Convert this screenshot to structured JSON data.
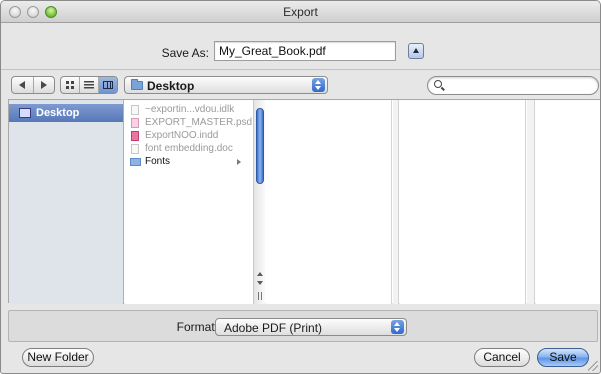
{
  "window": {
    "title": "Export"
  },
  "save_as": {
    "label": "Save As:",
    "value": "My_Great_Book.pdf"
  },
  "toolbar": {
    "location": "Desktop",
    "search_value": ""
  },
  "sidebar": {
    "items": [
      {
        "label": "Desktop",
        "selected": true
      }
    ]
  },
  "browser": {
    "files": [
      {
        "name": "~exportin...vdou.idlk",
        "enabled": false,
        "icon": "document-icon"
      },
      {
        "name": "EXPORT_MASTER.psd",
        "enabled": false,
        "icon": "psd-document-icon"
      },
      {
        "name": "ExportNOO.indd",
        "enabled": false,
        "icon": "indesign-document-icon"
      },
      {
        "name": "font embedding.doc",
        "enabled": false,
        "icon": "document-icon"
      },
      {
        "name": "Fonts",
        "enabled": true,
        "icon": "folder-icon"
      }
    ]
  },
  "format": {
    "label": "Format:",
    "value": "Adobe PDF (Print)"
  },
  "buttons": {
    "new_folder": "New Folder",
    "cancel": "Cancel",
    "save": "Save"
  },
  "colors": {
    "accent": "#5f95e4",
    "selection": "#5877b8",
    "sidebar_bg": "#dee4ea"
  }
}
